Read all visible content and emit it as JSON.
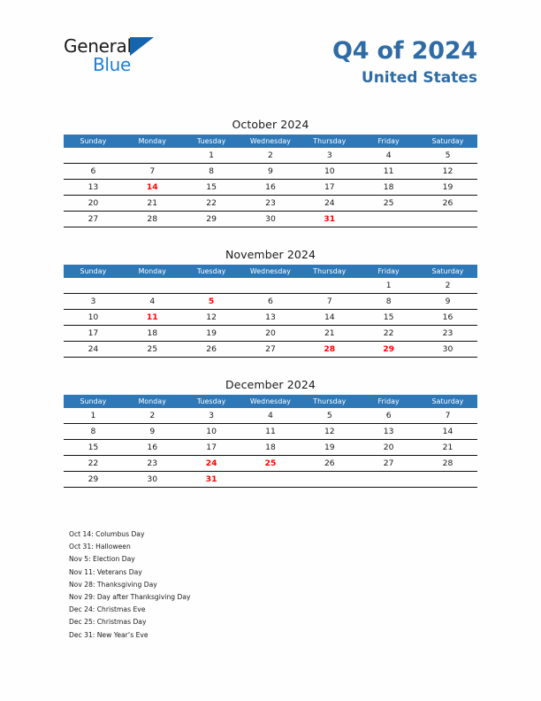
{
  "brand": {
    "name_part1": "General",
    "name_part2": "Blue",
    "triangle_icon": "triangle-icon"
  },
  "header": {
    "title": "Q4 of 2024",
    "subtitle": "United States"
  },
  "colors": {
    "header_blue": "#2e78b8",
    "title_blue": "#2f6ca5",
    "logo_blue": "#1f7fd4",
    "holiday_red": "#ff0000",
    "text": "#1a1a1a",
    "background": "#fefefe"
  },
  "weekdays": [
    "Sunday",
    "Monday",
    "Tuesday",
    "Wednesday",
    "Thursday",
    "Friday",
    "Saturday"
  ],
  "months": [
    {
      "title": "October 2024",
      "weeks": [
        [
          {
            "d": "",
            "h": false
          },
          {
            "d": "",
            "h": false
          },
          {
            "d": "1",
            "h": false
          },
          {
            "d": "2",
            "h": false
          },
          {
            "d": "3",
            "h": false
          },
          {
            "d": "4",
            "h": false
          },
          {
            "d": "5",
            "h": false
          }
        ],
        [
          {
            "d": "6",
            "h": false
          },
          {
            "d": "7",
            "h": false
          },
          {
            "d": "8",
            "h": false
          },
          {
            "d": "9",
            "h": false
          },
          {
            "d": "10",
            "h": false
          },
          {
            "d": "11",
            "h": false
          },
          {
            "d": "12",
            "h": false
          }
        ],
        [
          {
            "d": "13",
            "h": false
          },
          {
            "d": "14",
            "h": true
          },
          {
            "d": "15",
            "h": false
          },
          {
            "d": "16",
            "h": false
          },
          {
            "d": "17",
            "h": false
          },
          {
            "d": "18",
            "h": false
          },
          {
            "d": "19",
            "h": false
          }
        ],
        [
          {
            "d": "20",
            "h": false
          },
          {
            "d": "21",
            "h": false
          },
          {
            "d": "22",
            "h": false
          },
          {
            "d": "23",
            "h": false
          },
          {
            "d": "24",
            "h": false
          },
          {
            "d": "25",
            "h": false
          },
          {
            "d": "26",
            "h": false
          }
        ],
        [
          {
            "d": "27",
            "h": false
          },
          {
            "d": "28",
            "h": false
          },
          {
            "d": "29",
            "h": false
          },
          {
            "d": "30",
            "h": false
          },
          {
            "d": "31",
            "h": true
          },
          {
            "d": "",
            "h": false
          },
          {
            "d": "",
            "h": false
          }
        ]
      ]
    },
    {
      "title": "November 2024",
      "weeks": [
        [
          {
            "d": "",
            "h": false
          },
          {
            "d": "",
            "h": false
          },
          {
            "d": "",
            "h": false
          },
          {
            "d": "",
            "h": false
          },
          {
            "d": "",
            "h": false
          },
          {
            "d": "1",
            "h": false
          },
          {
            "d": "2",
            "h": false
          }
        ],
        [
          {
            "d": "3",
            "h": false
          },
          {
            "d": "4",
            "h": false
          },
          {
            "d": "5",
            "h": true
          },
          {
            "d": "6",
            "h": false
          },
          {
            "d": "7",
            "h": false
          },
          {
            "d": "8",
            "h": false
          },
          {
            "d": "9",
            "h": false
          }
        ],
        [
          {
            "d": "10",
            "h": false
          },
          {
            "d": "11",
            "h": true
          },
          {
            "d": "12",
            "h": false
          },
          {
            "d": "13",
            "h": false
          },
          {
            "d": "14",
            "h": false
          },
          {
            "d": "15",
            "h": false
          },
          {
            "d": "16",
            "h": false
          }
        ],
        [
          {
            "d": "17",
            "h": false
          },
          {
            "d": "18",
            "h": false
          },
          {
            "d": "19",
            "h": false
          },
          {
            "d": "20",
            "h": false
          },
          {
            "d": "21",
            "h": false
          },
          {
            "d": "22",
            "h": false
          },
          {
            "d": "23",
            "h": false
          }
        ],
        [
          {
            "d": "24",
            "h": false
          },
          {
            "d": "25",
            "h": false
          },
          {
            "d": "26",
            "h": false
          },
          {
            "d": "27",
            "h": false
          },
          {
            "d": "28",
            "h": true
          },
          {
            "d": "29",
            "h": true
          },
          {
            "d": "30",
            "h": false
          }
        ]
      ]
    },
    {
      "title": "December 2024",
      "weeks": [
        [
          {
            "d": "1",
            "h": false
          },
          {
            "d": "2",
            "h": false
          },
          {
            "d": "3",
            "h": false
          },
          {
            "d": "4",
            "h": false
          },
          {
            "d": "5",
            "h": false
          },
          {
            "d": "6",
            "h": false
          },
          {
            "d": "7",
            "h": false
          }
        ],
        [
          {
            "d": "8",
            "h": false
          },
          {
            "d": "9",
            "h": false
          },
          {
            "d": "10",
            "h": false
          },
          {
            "d": "11",
            "h": false
          },
          {
            "d": "12",
            "h": false
          },
          {
            "d": "13",
            "h": false
          },
          {
            "d": "14",
            "h": false
          }
        ],
        [
          {
            "d": "15",
            "h": false
          },
          {
            "d": "16",
            "h": false
          },
          {
            "d": "17",
            "h": false
          },
          {
            "d": "18",
            "h": false
          },
          {
            "d": "19",
            "h": false
          },
          {
            "d": "20",
            "h": false
          },
          {
            "d": "21",
            "h": false
          }
        ],
        [
          {
            "d": "22",
            "h": false
          },
          {
            "d": "23",
            "h": false
          },
          {
            "d": "24",
            "h": true
          },
          {
            "d": "25",
            "h": true
          },
          {
            "d": "26",
            "h": false
          },
          {
            "d": "27",
            "h": false
          },
          {
            "d": "28",
            "h": false
          }
        ],
        [
          {
            "d": "29",
            "h": false
          },
          {
            "d": "30",
            "h": false
          },
          {
            "d": "31",
            "h": true
          },
          {
            "d": "",
            "h": false
          },
          {
            "d": "",
            "h": false
          },
          {
            "d": "",
            "h": false
          },
          {
            "d": "",
            "h": false
          }
        ]
      ]
    }
  ],
  "holidays": [
    "Oct 14: Columbus Day",
    "Oct 31: Halloween",
    "Nov 5: Election Day",
    "Nov 11: Veterans Day",
    "Nov 28: Thanksgiving Day",
    "Nov 29: Day after Thanksgiving Day",
    "Dec 24: Christmas Eve",
    "Dec 25: Christmas Day",
    "Dec 31: New Year’s Eve"
  ]
}
